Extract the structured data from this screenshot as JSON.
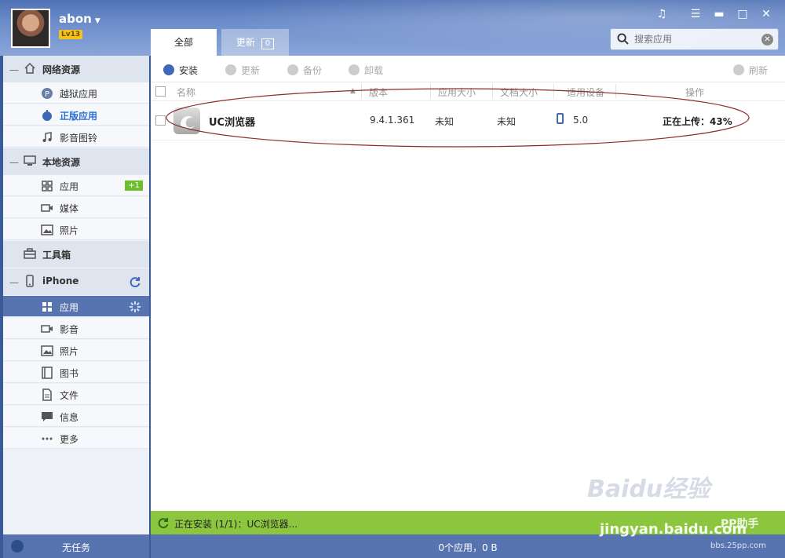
{
  "user": {
    "name": "abon",
    "level": "Lv13"
  },
  "window_controls": [
    "music-icon",
    "menu-icon",
    "minimize-icon",
    "maximize-icon",
    "close-icon"
  ],
  "tabs": [
    {
      "label": "全部",
      "active": true
    },
    {
      "label": "更新",
      "count": "0"
    }
  ],
  "search": {
    "placeholder": "搜索应用"
  },
  "sidebar": {
    "groups": [
      {
        "label": "网络资源",
        "icon": "home-icon",
        "items": [
          {
            "label": "越狱应用",
            "icon": "p-icon"
          },
          {
            "label": "正版应用",
            "icon": "apple-icon",
            "highlight": true
          },
          {
            "label": "影音图铃",
            "icon": "music-note-icon"
          }
        ]
      },
      {
        "label": "本地资源",
        "icon": "monitor-icon",
        "items": [
          {
            "label": "应用",
            "icon": "grid-icon",
            "badge": "+1"
          },
          {
            "label": "媒体",
            "icon": "video-icon"
          },
          {
            "label": "照片",
            "icon": "image-icon"
          }
        ]
      },
      {
        "label": "工具箱",
        "icon": "toolbox-icon"
      },
      {
        "label": "iPhone",
        "icon": "phone-icon",
        "items": [
          {
            "label": "应用",
            "icon": "grid-icon",
            "active": true
          },
          {
            "label": "影音",
            "icon": "video-icon"
          },
          {
            "label": "照片",
            "icon": "image-icon"
          },
          {
            "label": "图书",
            "icon": "book-icon"
          },
          {
            "label": "文件",
            "icon": "file-icon"
          },
          {
            "label": "信息",
            "icon": "message-icon"
          },
          {
            "label": "更多",
            "icon": "more-icon"
          }
        ]
      }
    ],
    "footer": "无任务"
  },
  "toolbar": {
    "install": "安装",
    "update": "更新",
    "backup": "备份",
    "uninstall": "卸载",
    "refresh": "刷新"
  },
  "table": {
    "columns": [
      "名称",
      "版本",
      "应用大小",
      "文档大小",
      "适用设备",
      "操作"
    ],
    "rows": [
      {
        "name": "UC浏览器",
        "version": "9.4.1.361",
        "app_size": "未知",
        "doc_size": "未知",
        "device": "5.0",
        "action": "正在上传：43%"
      }
    ]
  },
  "status": {
    "installing": "正在安装 (1/1)：UC浏览器...",
    "summary": "0个应用，0 B"
  },
  "watermarks": {
    "baidu": "Baidu经验",
    "jingyan": "jingyan.baidu.com",
    "pp": "PP助手",
    "site": "bbs.25pp.com"
  }
}
